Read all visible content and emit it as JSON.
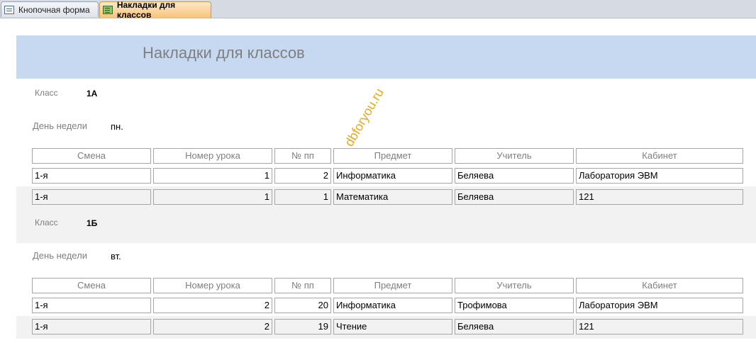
{
  "tabs": [
    {
      "label": "Кнопочная форма",
      "icon": "form-icon",
      "active": false
    },
    {
      "label": "Накладки для классов",
      "icon": "report-icon",
      "active": true
    }
  ],
  "report": {
    "title": "Накладки для классов",
    "class_label": "Класс",
    "day_label": "День недели",
    "columns": [
      "Смена",
      "Номер урока",
      "№ пп",
      "Предмет",
      "Учитель",
      "Кабинет"
    ],
    "groups": [
      {
        "class": "1А",
        "day": "пн.",
        "rows": [
          [
            "1-я",
            "1",
            "2",
            "Информатика",
            "Беляева",
            "Лаборатория ЭВМ"
          ],
          [
            "1-я",
            "1",
            "1",
            "Математика",
            "Беляева",
            "121"
          ]
        ]
      },
      {
        "class": "1Б",
        "day": "вт.",
        "rows": [
          [
            "1-я",
            "2",
            "20",
            "Информатика",
            "Трофимова",
            "Лаборатория ЭВМ"
          ],
          [
            "1-я",
            "2",
            "19",
            "Чтение",
            "Беляева",
            "121"
          ]
        ]
      }
    ]
  },
  "watermark": "dbforyou.ru",
  "colors": {
    "header_band": "#c6d9f1",
    "active_tab": "#f8c47a",
    "alt_row": "#f2f2f2",
    "watermark": "#e8a000"
  }
}
